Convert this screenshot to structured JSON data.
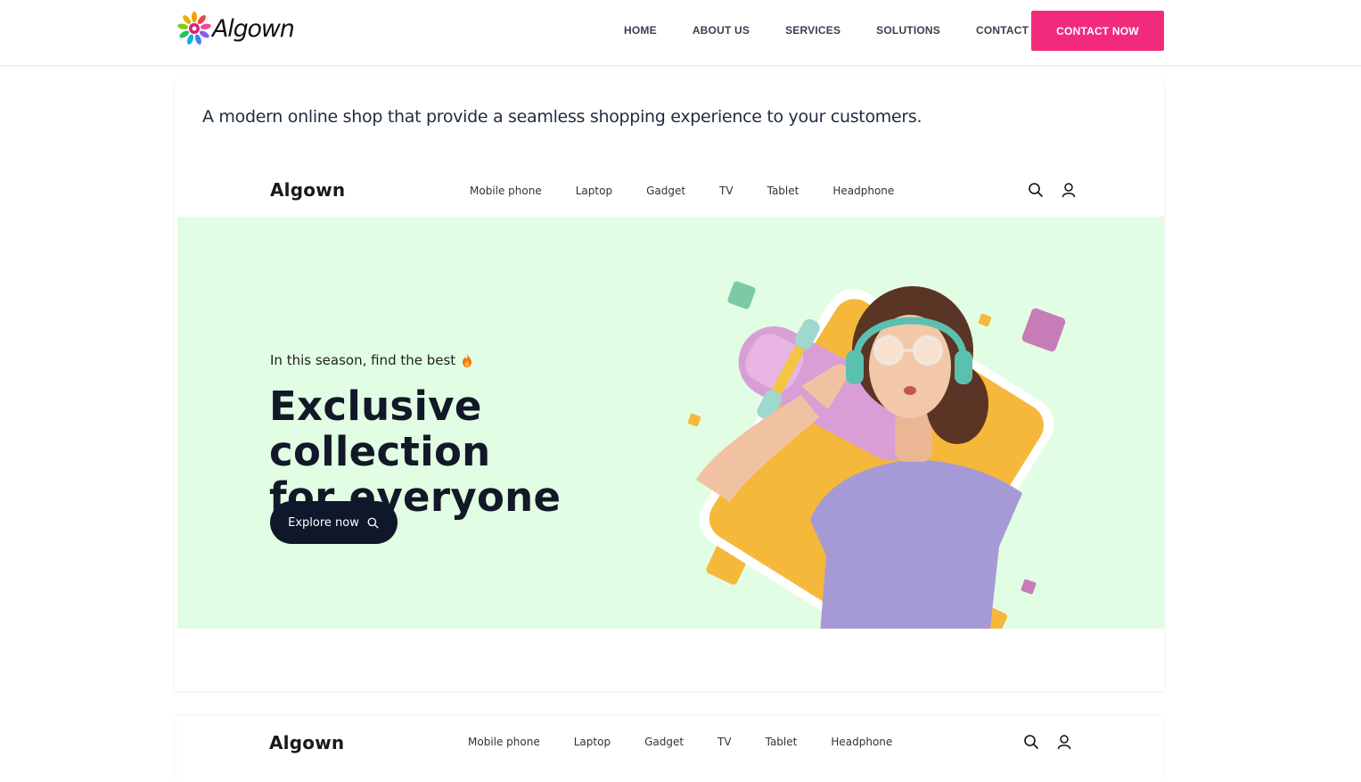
{
  "header": {
    "brand": "Algown",
    "nav": [
      "HOME",
      "ABOUT US",
      "SERVICES",
      "SOLUTIONS",
      "CONTACT"
    ],
    "cta": "CONTACT NOW",
    "cta_color": "#f22a7c"
  },
  "card": {
    "description": "A modern online shop that provide a seamless shopping experience to your customers."
  },
  "shop": {
    "logo": "Algown",
    "links": [
      "Mobile phone",
      "Laptop",
      "Gadget",
      "TV",
      "Tablet",
      "Headphone"
    ],
    "icons": [
      "search-icon",
      "user-icon"
    ],
    "hero": {
      "eyebrow": "In this season, find the best",
      "eyebrow_icon": "flame-icon",
      "title_line1": "Exclusive collection",
      "title_line2": "for everyone",
      "button": "Explore now",
      "bg_color": "#e1fde3"
    }
  },
  "shop2": {
    "logo": "Algown",
    "links": [
      "Mobile phone",
      "Laptop",
      "Gadget",
      "TV",
      "Tablet",
      "Headphone"
    ]
  }
}
